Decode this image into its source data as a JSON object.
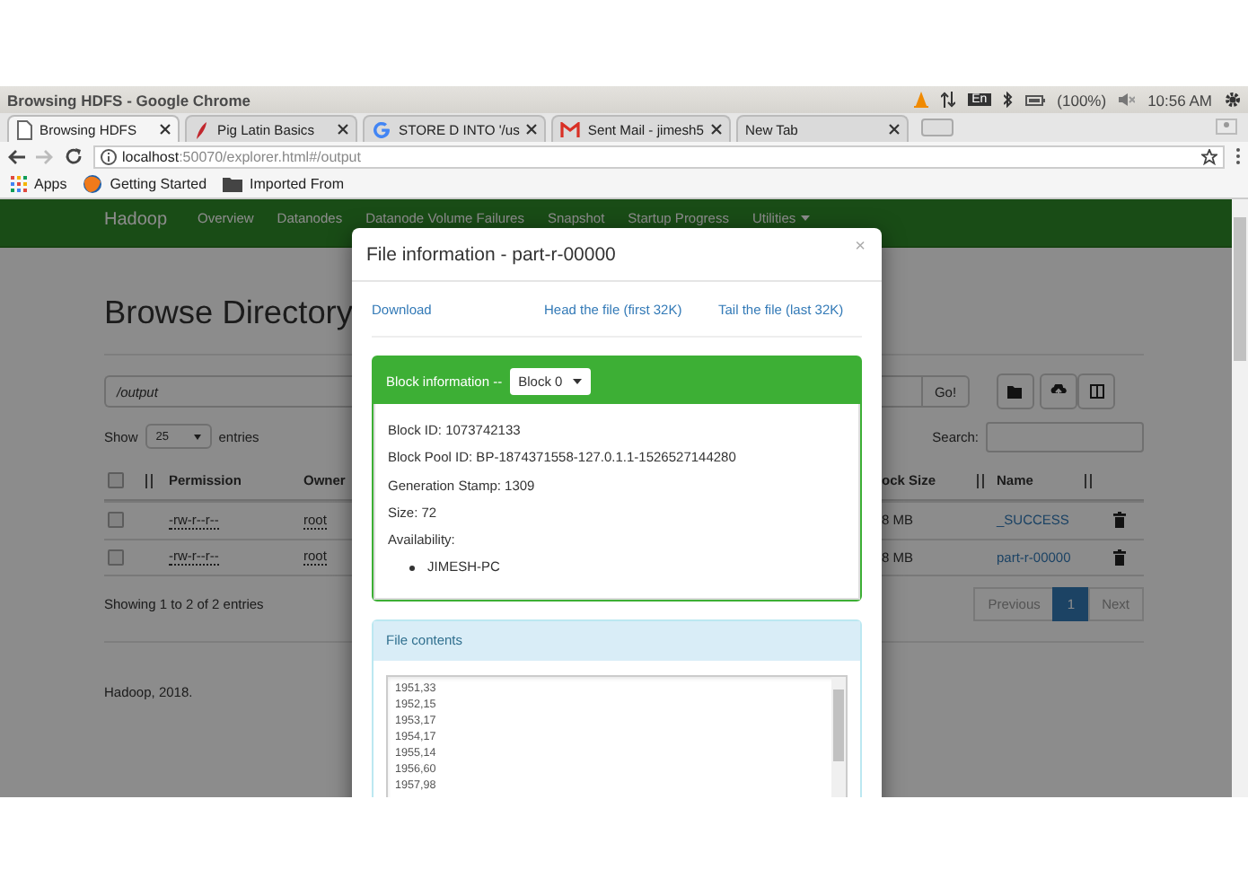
{
  "os_bar": {
    "title": "Browsing HDFS - Google Chrome",
    "input_method": "En",
    "battery": "(100%)",
    "time": "10:56 AM"
  },
  "tabs": [
    {
      "label": "Browsing HDFS",
      "selected": true,
      "kind": "page"
    },
    {
      "label": "Pig Latin Basics",
      "selected": false,
      "kind": "pig"
    },
    {
      "label": "STORE D INTO '/us",
      "selected": false,
      "kind": "google"
    },
    {
      "label": "Sent Mail - jimesh5",
      "selected": false,
      "kind": "gmail"
    },
    {
      "label": "New Tab",
      "selected": false,
      "kind": "blank"
    }
  ],
  "address": {
    "host": "localhost",
    "path": ":50070/explorer.html#/output"
  },
  "bookmarks": [
    {
      "label": "Apps",
      "kind": "apps"
    },
    {
      "label": "Getting Started",
      "kind": "firefox"
    },
    {
      "label": "Imported From",
      "kind": "folder"
    }
  ],
  "navbar": {
    "brand": "Hadoop",
    "items": [
      {
        "label": "Overview",
        "dropdown": false
      },
      {
        "label": "Datanodes",
        "dropdown": false
      },
      {
        "label": "Datanode Volume Failures",
        "dropdown": false
      },
      {
        "label": "Snapshot",
        "dropdown": false
      },
      {
        "label": "Startup Progress",
        "dropdown": false
      },
      {
        "label": "Utilities",
        "dropdown": true
      }
    ]
  },
  "page": {
    "heading": "Browse Directory",
    "path": "/output",
    "go": "Go!",
    "show_label": "Show",
    "page_size": "25",
    "entries_label": "entries",
    "search_label": "Search:"
  },
  "table": {
    "all_checked": false,
    "columns": [
      "Permission",
      "Owner",
      "ock Size",
      "Name"
    ],
    "rows": [
      {
        "checked": false,
        "permission": "-rw-r--r--",
        "owner": "root",
        "block_size": "8 MB",
        "name": "_SUCCESS"
      },
      {
        "checked": false,
        "permission": "-rw-r--r--",
        "owner": "root",
        "block_size": "8 MB",
        "name": "part-r-00000"
      }
    ]
  },
  "info": "Showing 1 to 2 of 2 entries",
  "pagination": [
    {
      "label": "Previous",
      "selected": false
    },
    {
      "label": "1",
      "selected": true
    },
    {
      "label": "Next",
      "selected": false
    }
  ],
  "footer": "Hadoop, 2018.",
  "modal": {
    "title": "File information - part-r-00000",
    "close": "×",
    "links": [
      "Download",
      "Head the file (first 32K)",
      "Tail the file (last 32K)"
    ],
    "block_label": "Block information --",
    "block_select": "Block 0",
    "block_details": [
      "Block ID: 1073742133",
      "Block Pool ID: BP-1874371558-127.0.1.1-1526527144280",
      "Generation Stamp: 1309",
      "Size: 72",
      "Availability:"
    ],
    "availability": [
      "JIMESH-PC"
    ],
    "contents_title": "File contents",
    "contents": [
      "1951,33",
      "1952,15",
      "1953,17",
      "1954,17",
      "1955,14",
      "1956,60",
      "1957,98"
    ]
  }
}
